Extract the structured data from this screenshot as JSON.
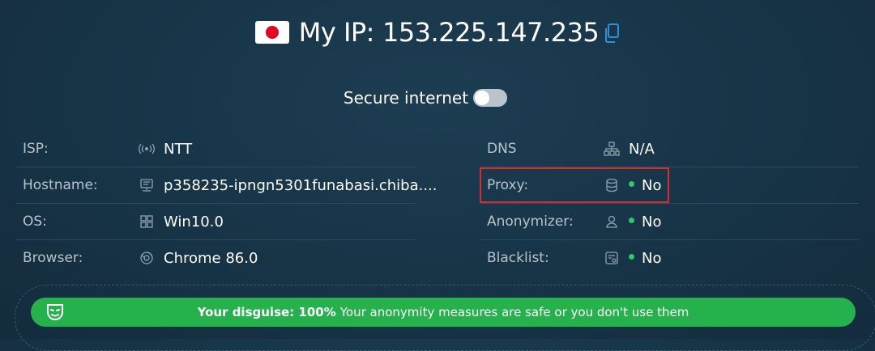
{
  "header": {
    "ip_label": "My IP:",
    "ip_value": "153.225.147.235",
    "flag_icon": "japan-flag-icon",
    "copy_icon": "copy-icon"
  },
  "secure": {
    "label": "Secure internet",
    "enabled": false
  },
  "left_rows": [
    {
      "label": "ISP:",
      "value": "NTT",
      "icon": "wifi-signal-icon"
    },
    {
      "label": "Hostname:",
      "value": "p358235-ipngn5301funabasi.chiba....",
      "icon": "server-icon"
    },
    {
      "label": "OS:",
      "value": "Win10.0",
      "icon": "windows-icon"
    },
    {
      "label": "Browser:",
      "value": "Chrome 86.0",
      "icon": "browser-icon"
    }
  ],
  "right_rows": [
    {
      "label": "DNS",
      "value": "N/A",
      "icon": "network-icon"
    },
    {
      "label": "Proxy:",
      "value": "No",
      "icon": "database-icon",
      "status_dot": true
    },
    {
      "label": "Anonymizer:",
      "value": "No",
      "icon": "user-icon",
      "status_dot": true
    },
    {
      "label": "Blacklist:",
      "value": "No",
      "icon": "blacklist-icon",
      "status_dot": true
    }
  ],
  "banner": {
    "bold": "Your disguise: 100%",
    "text": "Your anonymity measures are safe or you don't use them",
    "icon": "mask-icon"
  },
  "colors": {
    "background": "#173447",
    "accent_green": "#25b24d",
    "status_dot": "#2ec76a",
    "highlight_red": "#d92b2b"
  }
}
